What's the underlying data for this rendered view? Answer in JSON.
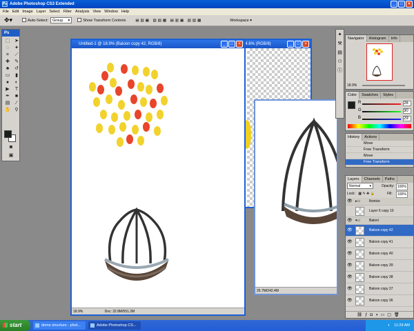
{
  "app": {
    "title": "Adobe Photoshop CS3 Extended",
    "icon": "Ps",
    "colors": {
      "titlebar": "#0045c0",
      "selection": "#316ac5"
    }
  },
  "menu": [
    "File",
    "Edit",
    "Image",
    "Layer",
    "Select",
    "Filter",
    "Analysis",
    "View",
    "Window",
    "Help"
  ],
  "options": {
    "auto_select_label": "Auto-Select:",
    "auto_select_value": "Group",
    "show_transform_label": "Show Transform Controls",
    "workspace_label": "Workspace ▾"
  },
  "toolbox": {
    "header": "Ps"
  },
  "doc_main": {
    "title": "Untitled-1 @ 18.9% (Baloon copy 42, RGB/8)",
    "zoom": "18.9%",
    "info": "Doc: 32.8M/551.2M"
  },
  "doc_back": {
    "title": "14.6% (RGB/8)",
    "info": "26.7M/242.4M"
  },
  "navigator": {
    "tabs": [
      "Navigator",
      "Histogram",
      "Info"
    ],
    "zoom": "18.9%"
  },
  "color": {
    "tabs": [
      "Color",
      "Swatches",
      "Styles"
    ],
    "r": "26",
    "g": "30",
    "b": "29",
    "r_label": "R",
    "g_label": "G",
    "b_label": "B"
  },
  "history": {
    "tabs": [
      "History",
      "Actions"
    ],
    "items": [
      "Move",
      "Free Transform",
      "Move",
      "Free Transform"
    ],
    "selected": 3
  },
  "layers": {
    "tabs": [
      "Layers",
      "Channels",
      "Paths"
    ],
    "blend": "Normal",
    "opacity_label": "Opacity:",
    "opacity": "100%",
    "lock_label": "Lock:",
    "fill_label": "Fill:",
    "fill": "100%",
    "rows": [
      {
        "name": "Ikonice",
        "type": "group"
      },
      {
        "name": "Layer 6 copy 10",
        "type": "layer"
      },
      {
        "name": "Baloni",
        "type": "group"
      },
      {
        "name": "Baloon copy 42",
        "type": "layer",
        "selected": true
      },
      {
        "name": "Baloon copy 41",
        "type": "layer"
      },
      {
        "name": "Baloon copy 40",
        "type": "layer"
      },
      {
        "name": "Baloon copy 39",
        "type": "layer"
      },
      {
        "name": "Baloon copy 38",
        "type": "layer"
      },
      {
        "name": "Baloon copy 37",
        "type": "layer"
      },
      {
        "name": "Baloon copy 36",
        "type": "layer"
      }
    ]
  },
  "taskbar": {
    "start": "start",
    "tasks": [
      "dome structure - phot...",
      "Adobe Photoshop CS..."
    ],
    "time": "11:29 AM"
  }
}
